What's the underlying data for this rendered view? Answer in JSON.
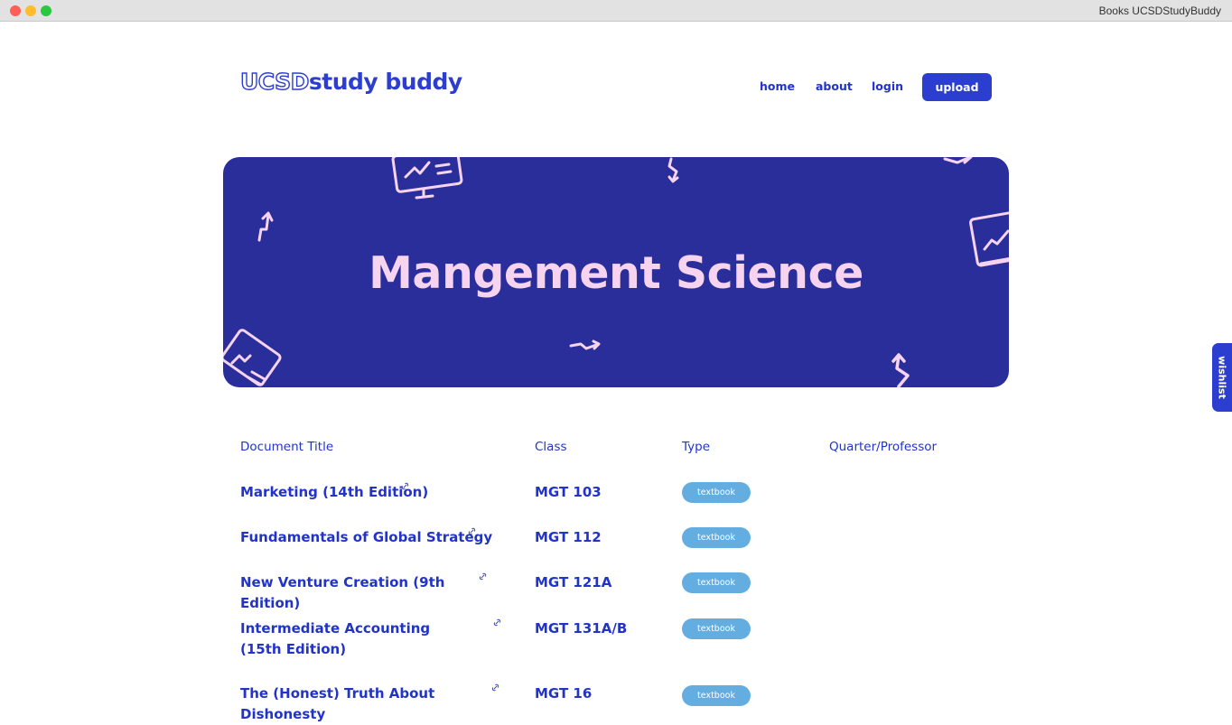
{
  "window": {
    "title": "Books UCSDStudyBuddy"
  },
  "header": {
    "logo_outline": "UCSD",
    "logo_text": "study buddy",
    "nav": {
      "home": "home",
      "about": "about",
      "login": "login",
      "upload": "upload"
    }
  },
  "hero": {
    "title": "Mangement Science"
  },
  "wishlist": {
    "label": "wishlist"
  },
  "table": {
    "headers": [
      "Document Title",
      "Class",
      "Type",
      "Quarter/Professor"
    ],
    "rows": [
      {
        "title": "Marketing (14th Edition)",
        "class": "MGT 103",
        "type": "textbook"
      },
      {
        "title": "Fundamentals of Global Strategy",
        "class": "MGT 112",
        "type": "textbook"
      },
      {
        "title": "New Venture Creation (9th Edition)",
        "class": "MGT 121A",
        "type": "textbook"
      },
      {
        "title": "Intermediate Accounting (15th Edition)",
        "class": "MGT 131A/B",
        "type": "textbook"
      },
      {
        "title": "The (Honest) Truth About Dishonesty",
        "class": "MGT 16",
        "type": "textbook"
      }
    ]
  },
  "colors": {
    "brand": "#2b3ecf",
    "hero_bg": "#2a2e9b",
    "hero_text": "#f6d3ee",
    "badge": "#64ade0"
  }
}
